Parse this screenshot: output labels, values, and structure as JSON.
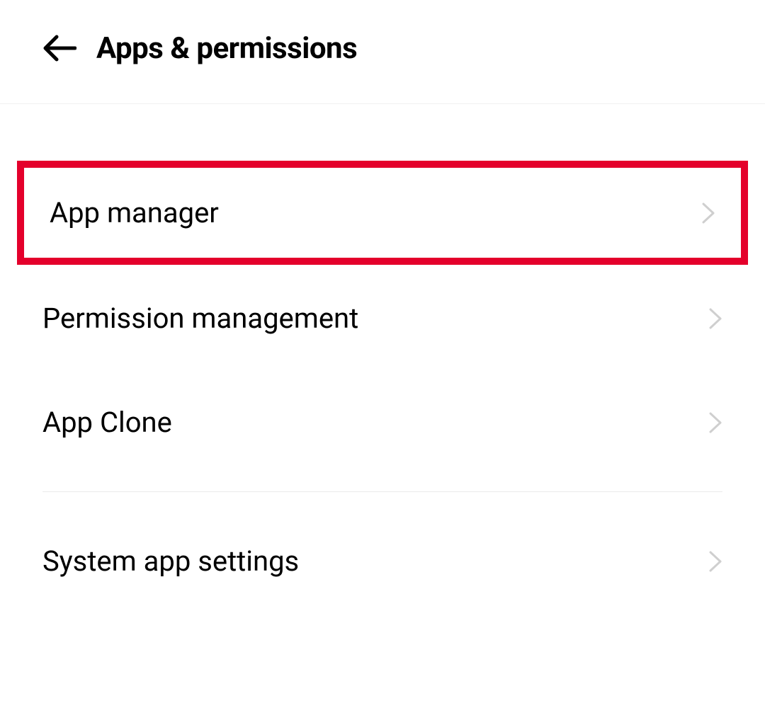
{
  "header": {
    "title": "Apps & permissions"
  },
  "items": [
    {
      "label": "App manager",
      "highlighted": true
    },
    {
      "label": "Permission management",
      "highlighted": false
    },
    {
      "label": "App Clone",
      "highlighted": false
    },
    {
      "label": "System app settings",
      "highlighted": false
    }
  ],
  "colors": {
    "highlight": "#e4002b"
  }
}
